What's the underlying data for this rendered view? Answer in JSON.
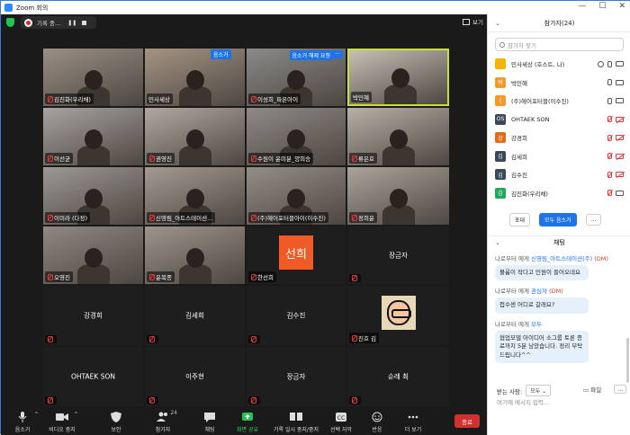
{
  "window": {
    "title": "Zoom 회의",
    "controls": [
      "—",
      "☐",
      "✕"
    ]
  },
  "topbar": {
    "recording_label": "기록 중...",
    "pause_glyph": "❚❚",
    "view_label": "보기"
  },
  "tiles": [
    {
      "name": "김진화(우리채)",
      "type": "video",
      "muted": true
    },
    {
      "name": "민사세상",
      "type": "video",
      "muted": false
    },
    {
      "name": "",
      "type": "video",
      "muted": false,
      "badge": "음소거"
    },
    {
      "name": "이성희_파온아이",
      "type": "video",
      "muted": true,
      "badge": "음소거 해제 요청"
    },
    {
      "name": "박민혜",
      "type": "video",
      "muted": false,
      "active": true
    },
    {
      "name": "이선균",
      "type": "video",
      "muted": true
    },
    {
      "name": "권영진",
      "type": "video",
      "muted": true
    },
    {
      "name": "수원이 윤미분_양희승",
      "type": "video",
      "muted": true
    },
    {
      "name": "류은호",
      "type": "video",
      "muted": true
    },
    {
      "name": "이미라 (다정)",
      "type": "video",
      "muted": true
    },
    {
      "name": "신영림_아트스테이션...",
      "type": "video",
      "muted": true
    },
    {
      "name": "(주)헤어포터블아이(이수진)",
      "type": "video",
      "muted": true
    },
    {
      "name": "정희윤",
      "type": "video",
      "muted": true
    },
    {
      "name": "오영진",
      "type": "video",
      "muted": true
    },
    {
      "name": "윤복종",
      "type": "video",
      "muted": true
    },
    {
      "name": "한선희",
      "type": "avatar",
      "avatar_text": "선희",
      "muted": true
    },
    {
      "name": "장금자",
      "type": "name",
      "muted": true
    },
    {
      "name": "강경희",
      "type": "name",
      "muted": true
    },
    {
      "name": "김세희",
      "type": "name",
      "muted": true
    },
    {
      "name": "김수진",
      "type": "name",
      "muted": true
    },
    {
      "name": "진호 김",
      "type": "cartoon",
      "muted": true
    },
    {
      "name": "OHTAEK SON",
      "type": "name",
      "muted": true
    },
    {
      "name": "이주현",
      "type": "name",
      "muted": true
    },
    {
      "name": "장금자",
      "type": "name",
      "muted": true
    },
    {
      "name": "순례 최",
      "type": "name",
      "muted": true
    }
  ],
  "toolbar": {
    "mute": "음소거",
    "video": "비디오 중지",
    "security": "보안",
    "participants": "참가자",
    "participants_count": "24",
    "chat": "채팅",
    "share": "화면 공유",
    "record": "기록 일시 중지/중지",
    "caption": "선택 자막",
    "reactions": "반응",
    "more": "더 보기",
    "end": "종료"
  },
  "panel": {
    "title": "참가자(24)",
    "search_placeholder": "참가자 찾기",
    "participants": [
      {
        "name": "민사세상 (호스트, 나)",
        "initial": "",
        "color": "#f4b400",
        "mic": "on",
        "cam": "on",
        "host": true
      },
      {
        "name": "박민혜",
        "initial": "박",
        "color": "#f29a2e",
        "mic": "on",
        "cam": "on"
      },
      {
        "name": "(주)헤어포터블(이수진)",
        "initial": "(",
        "color": "#f29a2e",
        "mic": "on",
        "cam": "on"
      },
      {
        "name": "OHTAEK SON",
        "initial": "OS",
        "color": "#3a4a5a",
        "mic": "off",
        "cam": "off"
      },
      {
        "name": "강경희",
        "initial": "강",
        "color": "#e26b1a",
        "mic": "off",
        "cam": "off"
      },
      {
        "name": "김세희",
        "initial": "김",
        "color": "#3a4a5a",
        "mic": "off",
        "cam": "off"
      },
      {
        "name": "김수진",
        "initial": "김",
        "color": "#3a4a5a",
        "mic": "off",
        "cam": "off"
      },
      {
        "name": "김진화(우리채)",
        "initial": "김",
        "color": "#22a85a",
        "mic": "off",
        "cam": "on"
      }
    ],
    "invite": "초대",
    "mute_all": "모두 음소거",
    "more": "...",
    "chat_title": "채팅",
    "messages": [
      {
        "from": "나로부터 에게",
        "to": "신영림_아트스테이션(주)",
        "dm": "(DM)",
        "text": "볼륨이 작다고 민원이 들어오네요"
      },
      {
        "from": "나로부터 에게",
        "to": "권심자",
        "dm": "(DM)",
        "text": "접수센 어디로 갈래요?"
      },
      {
        "from": "나로부터 에게",
        "to": "모두",
        "dm": "",
        "text": "협업모델 아이디어 소그룹 토론 종료까지 5분 남았습니다. 정리 부탁드립니다^^"
      }
    ],
    "send_to_label": "받는 사람:",
    "send_to_value": "모두",
    "file_label": "파일",
    "input_placeholder": "여기에 메시지 입력..."
  }
}
